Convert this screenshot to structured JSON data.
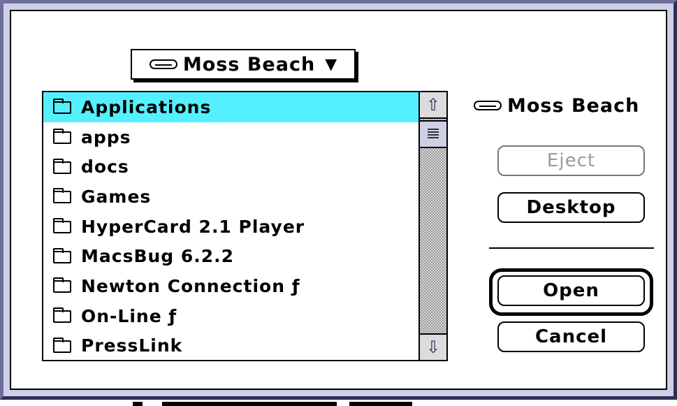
{
  "popup_menu": {
    "label": "Moss Beach",
    "icon": "hard-disk-icon",
    "arrow": "▼"
  },
  "volume": {
    "label": "Moss Beach",
    "icon": "hard-disk-icon"
  },
  "files": [
    {
      "name": "Applications",
      "icon": "folder-icon",
      "selected": true
    },
    {
      "name": "apps",
      "icon": "folder-icon",
      "selected": false
    },
    {
      "name": "docs",
      "icon": "folder-icon",
      "selected": false
    },
    {
      "name": "Games",
      "icon": "folder-icon",
      "selected": false
    },
    {
      "name": "HyperCard 2.1 Player",
      "icon": "folder-icon",
      "selected": false
    },
    {
      "name": "MacsBug 6.2.2",
      "icon": "folder-icon",
      "selected": false
    },
    {
      "name": "Newton Connection ƒ",
      "icon": "folder-icon",
      "selected": false
    },
    {
      "name": "On-Line ƒ",
      "icon": "folder-icon",
      "selected": false
    },
    {
      "name": "PressLink",
      "icon": "folder-icon",
      "selected": false
    }
  ],
  "scrollbar": {
    "up_arrow": "⇧",
    "down_arrow": "⇩"
  },
  "buttons": {
    "eject": {
      "label": "Eject",
      "enabled": false
    },
    "desktop": {
      "label": "Desktop",
      "enabled": true
    },
    "open": {
      "label": "Open",
      "enabled": true,
      "default": true
    },
    "cancel": {
      "label": "Cancel",
      "enabled": true
    }
  },
  "colors": {
    "selection": "#55f0ff",
    "frame": "#6f6f9e",
    "scrollbar_arrows": "#2a2a55"
  }
}
